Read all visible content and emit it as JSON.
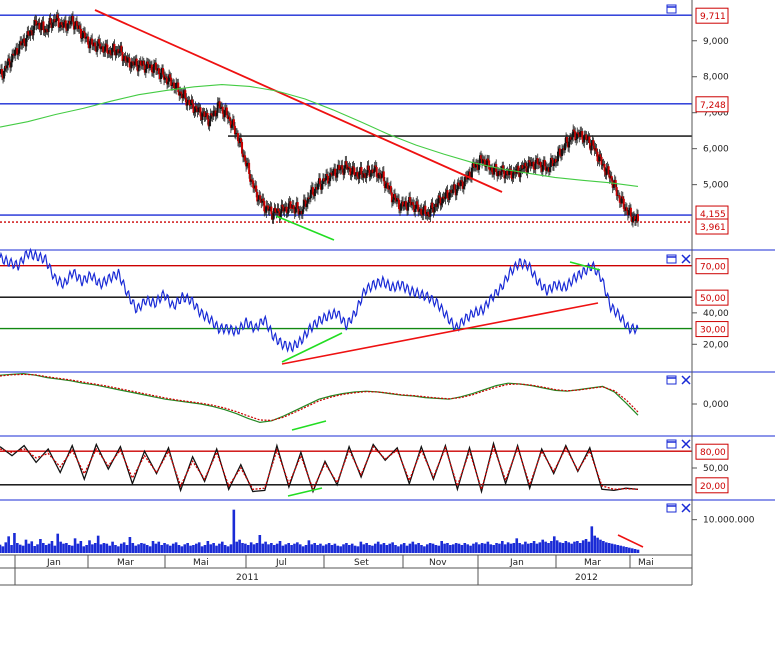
{
  "colors": {
    "panel_border": "#1a2bd6",
    "price_up": "#111111",
    "price_down": "#cc0000",
    "ma": "#44cc44",
    "trendline": "#ee1111",
    "divergence": "#22dd22",
    "rsi": "#1a2bd6",
    "hline_blue": "#1a2bd6",
    "hline_black": "#000000",
    "hline_red": "#cc0000",
    "hline_green": "#118811",
    "volume": "#1a2bd6",
    "tag_border": "#cc0000",
    "tag_text": "#cc0000"
  },
  "icons": {
    "maximize": "window-maximize-icon",
    "close": "close-x-icon"
  },
  "x_axis": {
    "months": [
      "Jan",
      "Mar",
      "Mai",
      "Jul",
      "Set",
      "Nov",
      "Jan",
      "Mar",
      "Mai"
    ],
    "years": [
      "2011",
      "2012"
    ]
  },
  "chart_data": [
    {
      "type": "candlestick",
      "panel": "price",
      "y_ticks": [
        "9,000",
        "8,000",
        "7,000",
        "6,000",
        "5,000"
      ],
      "value_tags": [
        "9,711",
        "7,248",
        "4,155",
        "3,961"
      ],
      "levels": {
        "blue": [
          9.711,
          7.248,
          4.155
        ],
        "black": [
          6.35
        ],
        "red_dotted": [
          3.961
        ]
      },
      "series": [
        {
          "name": "",
          "values": [
            8.0,
            8.4,
            8.8,
            9.1,
            9.5,
            9.3,
            9.6,
            9.4,
            9.55,
            9.2,
            8.9,
            8.85,
            8.7,
            8.75,
            8.4,
            8.35,
            8.3,
            8.25,
            8.0,
            7.8,
            7.5,
            7.2,
            7.0,
            6.8,
            7.2,
            6.9,
            6.4,
            5.6,
            4.8,
            4.4,
            4.2,
            4.3,
            4.4,
            4.25,
            4.7,
            5.0,
            5.2,
            5.4,
            5.5,
            5.3,
            5.3,
            5.4,
            5.2,
            4.7,
            4.4,
            4.5,
            4.3,
            4.2,
            4.5,
            4.7,
            4.9,
            5.1,
            5.5,
            5.7,
            5.4,
            5.35,
            5.3,
            5.4,
            5.55,
            5.6,
            5.45,
            5.7,
            6.1,
            6.4,
            6.35,
            6.1,
            5.6,
            5.2,
            4.6,
            4.2,
            3.98
          ]
        },
        {
          "name": "",
          "values": [
            6.6,
            6.75,
            6.95,
            7.12,
            7.32,
            7.5,
            7.62,
            7.72,
            7.78,
            7.73,
            7.6,
            7.38,
            7.08,
            6.75,
            6.4,
            6.1,
            5.85,
            5.62,
            5.45,
            5.32,
            5.2,
            5.12,
            5.05,
            4.95
          ]
        }
      ],
      "trendlines": [
        {
          "from": [
            "2010-12-15",
            9.7
          ],
          "to": [
            "2011-11-25",
            4.75
          ]
        },
        {
          "from": [
            "2011-01-10",
            6.35
          ],
          "to": [
            "2012-04-10",
            6.35
          ]
        }
      ]
    },
    {
      "type": "line",
      "panel": "rsi",
      "y_ticks": [
        "40,00",
        "20,00"
      ],
      "value_tags": [
        "70,00",
        "50,00",
        "30,00"
      ],
      "ylim": [
        10,
        80
      ],
      "levels": [
        {
          "value": 70,
          "color": "red"
        },
        {
          "value": 50,
          "color": "black"
        },
        {
          "value": 30,
          "color": "green"
        }
      ],
      "series": [
        {
          "name": "",
          "values": [
            75,
            72,
            70,
            78,
            76,
            74,
            62,
            58,
            66,
            60,
            64,
            58,
            62,
            65,
            52,
            42,
            48,
            46,
            52,
            44,
            50,
            48,
            40,
            36,
            30,
            30,
            28,
            34,
            30,
            36,
            25,
            20,
            18,
            22,
            30,
            35,
            38,
            40,
            32,
            40,
            54,
            58,
            60,
            56,
            58,
            54,
            52,
            50,
            46,
            38,
            30,
            36,
            40,
            42,
            50,
            56,
            66,
            72,
            70,
            60,
            54,
            58,
            56,
            62,
            66,
            70,
            62,
            44,
            38,
            30,
            30
          ]
        }
      ]
    },
    {
      "type": "line",
      "panel": "macd",
      "y_ticks": [
        "0,000"
      ],
      "series": [
        {
          "name": "",
          "values": [
            0.72,
            0.74,
            0.76,
            0.72,
            0.66,
            0.62,
            0.58,
            0.52,
            0.48,
            0.42,
            0.36,
            0.3,
            0.24,
            0.18,
            0.12,
            0.08,
            0.04,
            0.0,
            -0.06,
            -0.14,
            -0.24,
            -0.36,
            -0.46,
            -0.42,
            -0.3,
            -0.16,
            -0.02,
            0.12,
            0.2,
            0.26,
            0.3,
            0.32,
            0.3,
            0.26,
            0.22,
            0.2,
            0.16,
            0.14,
            0.12,
            0.18,
            0.26,
            0.36,
            0.46,
            0.52,
            0.5,
            0.46,
            0.4,
            0.34,
            0.32,
            0.36,
            0.4,
            0.44,
            0.3,
            0.02,
            -0.28
          ]
        },
        {
          "name": "",
          "values": [
            0.7,
            0.73,
            0.74,
            0.73,
            0.68,
            0.64,
            0.6,
            0.55,
            0.5,
            0.45,
            0.39,
            0.33,
            0.27,
            0.21,
            0.15,
            0.1,
            0.06,
            0.02,
            -0.03,
            -0.1,
            -0.19,
            -0.3,
            -0.4,
            -0.41,
            -0.33,
            -0.2,
            -0.06,
            0.08,
            0.17,
            0.24,
            0.28,
            0.31,
            0.3,
            0.27,
            0.23,
            0.21,
            0.18,
            0.15,
            0.13,
            0.16,
            0.23,
            0.33,
            0.42,
            0.49,
            0.5,
            0.47,
            0.42,
            0.36,
            0.33,
            0.35,
            0.39,
            0.43,
            0.33,
            0.1,
            -0.2
          ]
        }
      ]
    },
    {
      "type": "line",
      "panel": "stochastic",
      "y_ticks": [
        "50,00"
      ],
      "value_tags": [
        "80,00",
        "20,00"
      ],
      "ylim": [
        0,
        100
      ],
      "levels": [
        {
          "value": 80,
          "color": "red"
        },
        {
          "value": 20,
          "color": "black"
        }
      ],
      "series": [
        {
          "name": "",
          "values": [
            88,
            72,
            90,
            60,
            84,
            42,
            90,
            30,
            92,
            48,
            88,
            22,
            80,
            40,
            86,
            10,
            70,
            26,
            84,
            12,
            56,
            8,
            10,
            90,
            16,
            78,
            8,
            62,
            20,
            88,
            34,
            92,
            64,
            86,
            22,
            88,
            30,
            90,
            12,
            86,
            8,
            94,
            22,
            90,
            14,
            84,
            40,
            90,
            44,
            86,
            12,
            10,
            14,
            12
          ]
        },
        {
          "name": "",
          "values": [
            84,
            78,
            84,
            68,
            76,
            52,
            82,
            40,
            84,
            54,
            82,
            32,
            72,
            42,
            80,
            18,
            62,
            30,
            78,
            18,
            50,
            12,
            14,
            82,
            22,
            72,
            12,
            58,
            24,
            82,
            38,
            88,
            66,
            82,
            28,
            82,
            34,
            86,
            18,
            80,
            12,
            88,
            28,
            86,
            20,
            80,
            44,
            86,
            46,
            80,
            18,
            12,
            13,
            12
          ]
        }
      ]
    },
    {
      "type": "bar",
      "panel": "volume",
      "y_ticks": [
        "10.000.000"
      ],
      "trendlines": [
        {
          "from": [
            "2012-04-01",
            4000000
          ],
          "to": [
            "2012-04-25",
            900000
          ]
        }
      ],
      "values": [
        2.5,
        2.0,
        3.2,
        5.0,
        2.4,
        6.0,
        3.0,
        2.5,
        2.2,
        4.0,
        2.8,
        3.5,
        2.1,
        2.6,
        4.2,
        3.0,
        2.4,
        2.8,
        3.6,
        2.2,
        5.8,
        3.4,
        2.8,
        3.0,
        2.4,
        2.2,
        4.4,
        2.8,
        3.6,
        2.0,
        2.4,
        3.8,
        2.6,
        3.0,
        5.2,
        2.6,
        3.0,
        2.8,
        2.2,
        3.4,
        2.4,
        2.0,
        2.8,
        3.2,
        2.4,
        4.8,
        3.0,
        2.2,
        2.6,
        3.0,
        2.8,
        2.4,
        2.0,
        3.6,
        2.8,
        3.4,
        2.4,
        3.0,
        2.6,
        2.2,
        2.8,
        3.2,
        2.4,
        2.0,
        2.6,
        3.0,
        2.2,
        2.4,
        2.8,
        3.2,
        2.0,
        2.4,
        3.6,
        2.6,
        3.0,
        2.2,
        2.8,
        3.4,
        2.4,
        2.0,
        2.6,
        13.0,
        3.4,
        4.0,
        3.0,
        2.8,
        2.4,
        3.2,
        2.6,
        3.0,
        5.4,
        2.8,
        3.4,
        2.6,
        3.0,
        2.4,
        2.8,
        3.6,
        2.2,
        2.6,
        3.0,
        2.4,
        2.8,
        3.2,
        2.6,
        2.0,
        2.4,
        3.8,
        2.6,
        3.0,
        2.4,
        2.8,
        2.2,
        2.6,
        3.0,
        2.4,
        2.8,
        2.2,
        2.0,
        2.6,
        3.0,
        2.4,
        2.8,
        2.2,
        2.0,
        3.4,
        2.6,
        3.0,
        2.4,
        2.2,
        2.8,
        3.4,
        2.6,
        3.0,
        2.4,
        2.8,
        3.2,
        2.4,
        2.0,
        2.6,
        3.0,
        2.2,
        2.8,
        3.4,
        2.6,
        3.0,
        2.4,
        2.0,
        2.6,
        3.0,
        2.8,
        2.4,
        2.2,
        3.6,
        2.8,
        3.0,
        2.4,
        2.6,
        3.0,
        2.8,
        2.4,
        3.0,
        2.6,
        2.2,
        2.8,
        3.2,
        2.6,
        3.0,
        2.8,
        3.4,
        2.6,
        2.4,
        3.0,
        2.8,
        3.6,
        2.6,
        3.2,
        2.8,
        3.0,
        4.4,
        3.0,
        2.6,
        3.4,
        2.8,
        3.0,
        3.6,
        2.8,
        3.2,
        4.0,
        3.4,
        3.0,
        3.6,
        5.0,
        3.8,
        3.2,
        3.0,
        3.6,
        3.2,
        2.8,
        3.4,
        3.6,
        3.0,
        3.8,
        4.2,
        3.4,
        8.0,
        5.2,
        4.6,
        4.0,
        3.6,
        3.2,
        3.0,
        2.8,
        2.6,
        2.4,
        2.2,
        2.0,
        1.8,
        1.6,
        1.4,
        1.2,
        1.0
      ],
      "ylim": [
        0,
        15
      ]
    }
  ]
}
